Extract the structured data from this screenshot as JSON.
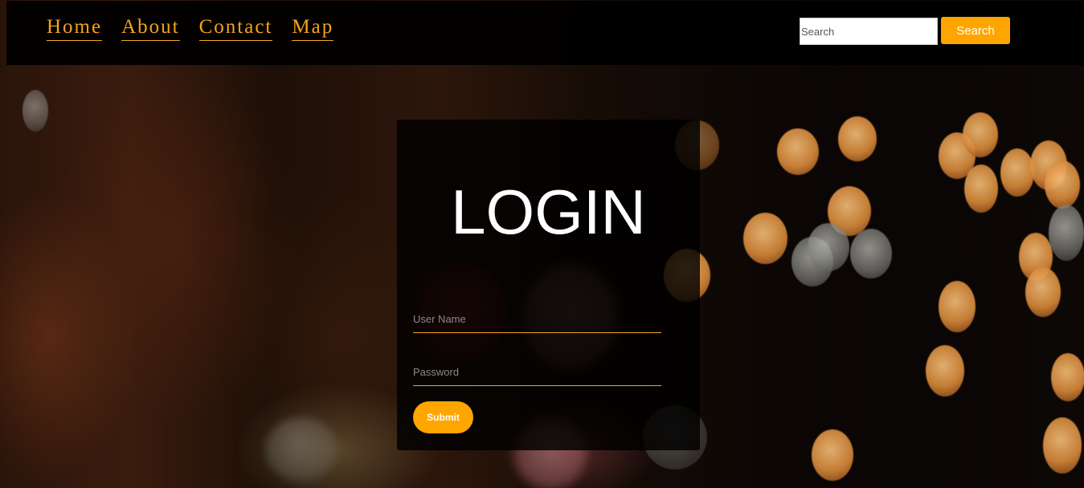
{
  "nav": {
    "links": [
      {
        "label": "Home"
      },
      {
        "label": "About"
      },
      {
        "label": "Contact"
      },
      {
        "label": "Map"
      }
    ],
    "search": {
      "placeholder": "Search",
      "value": "",
      "button_label": "Search"
    }
  },
  "login": {
    "title": "LOGIN",
    "username_placeholder": "User Name",
    "password_placeholder": "Password",
    "submit_label": "Submit"
  },
  "colors": {
    "accent": "#ffa500",
    "nav_link": "#f5a41a",
    "navbar_bg": "#000000",
    "card_bg": "#000000"
  }
}
